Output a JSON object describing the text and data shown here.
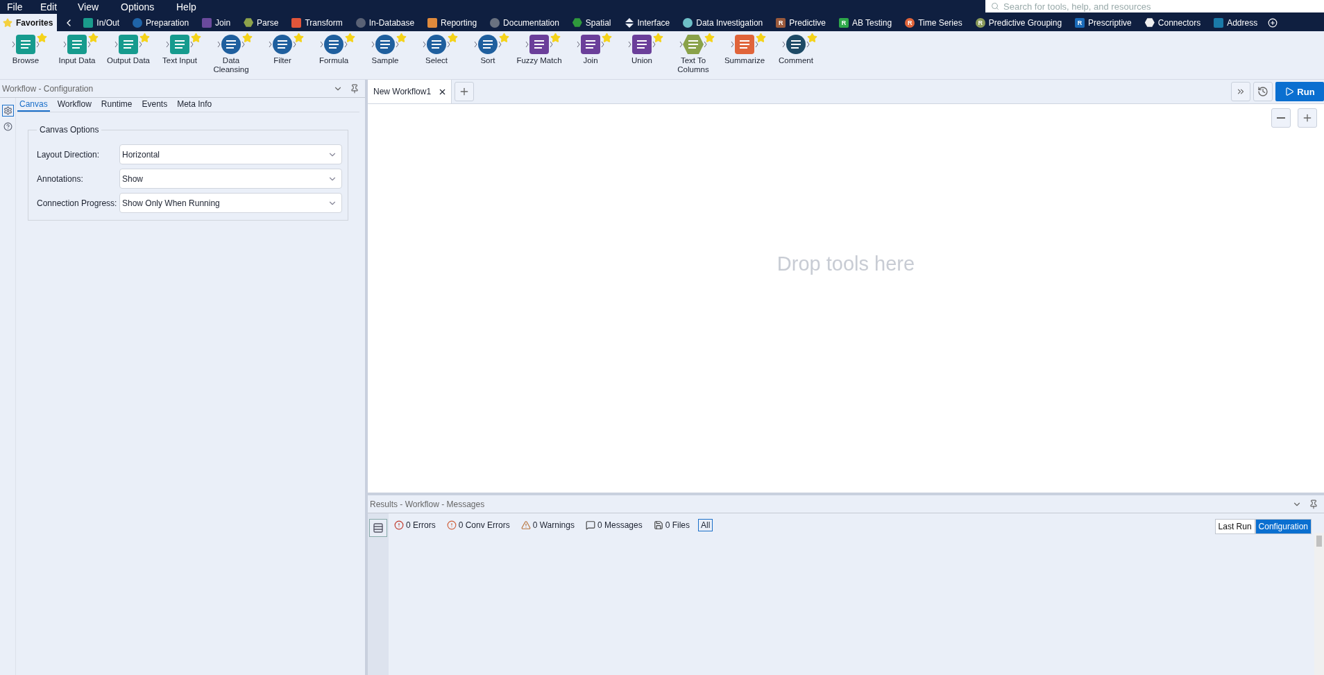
{
  "menu": [
    {
      "label": "File"
    },
    {
      "label": "Edit"
    },
    {
      "label": "View"
    },
    {
      "label": "Options"
    },
    {
      "label": "Help"
    }
  ],
  "search": {
    "placeholder": "Search for tools, help, and resources"
  },
  "category_tabs": [
    {
      "label": "Favorites",
      "selected": true,
      "kind": "star",
      "color": "#f4d03f"
    },
    {
      "label": "In/Out",
      "selected": false,
      "kind": "square",
      "color": "#1a9b8c"
    },
    {
      "label": "Preparation",
      "selected": false,
      "kind": "circle",
      "color": "#1f64a8"
    },
    {
      "label": "Join",
      "selected": false,
      "kind": "square",
      "color": "#6a4a9c"
    },
    {
      "label": "Parse",
      "selected": false,
      "kind": "hexagon",
      "color": "#8da24b"
    },
    {
      "label": "Transform",
      "selected": false,
      "kind": "square",
      "color": "#e0553a"
    },
    {
      "label": "In-Database",
      "selected": false,
      "kind": "circle",
      "color": "#5a6275"
    },
    {
      "label": "Reporting",
      "selected": false,
      "kind": "square",
      "color": "#e08a3c"
    },
    {
      "label": "Documentation",
      "selected": false,
      "kind": "circle",
      "color": "#6a7280"
    },
    {
      "label": "Spatial",
      "selected": false,
      "kind": "hexagon",
      "color": "#2f9a3c"
    },
    {
      "label": "Interface",
      "selected": false,
      "kind": "diamond",
      "color": "#e8ecf4"
    },
    {
      "label": "Data Investigation",
      "selected": false,
      "kind": "circle",
      "color": "#6ec0c8"
    },
    {
      "label": "Predictive",
      "selected": false,
      "kind": "badge",
      "color": "#9a5a3c",
      "badge": "R"
    },
    {
      "label": "AB Testing",
      "selected": false,
      "kind": "badge",
      "color": "#2ea84a",
      "badge": "R"
    },
    {
      "label": "Time Series",
      "selected": false,
      "kind": "round-badge",
      "color": "#e0643a",
      "badge": "R"
    },
    {
      "label": "Predictive Grouping",
      "selected": false,
      "kind": "round-badge",
      "color": "#8a9a5a",
      "badge": "R"
    },
    {
      "label": "Prescriptive",
      "selected": false,
      "kind": "badge",
      "color": "#1a6ab8",
      "badge": "R"
    },
    {
      "label": "Connectors",
      "selected": false,
      "kind": "hexagon",
      "color": "#f0f0f0"
    },
    {
      "label": "Address",
      "selected": false,
      "kind": "square",
      "color": "#1a7aa8"
    }
  ],
  "tools": [
    {
      "label": "Browse",
      "color": "#169b8e",
      "kind": "square"
    },
    {
      "label": "Input Data",
      "color": "#169b8e",
      "kind": "square"
    },
    {
      "label": "Output Data",
      "color": "#169b8e",
      "kind": "square"
    },
    {
      "label": "Text Input",
      "color": "#169b8e",
      "kind": "square"
    },
    {
      "label": "Data Cleansing",
      "color": "#1f5f9e",
      "kind": "circle"
    },
    {
      "label": "Filter",
      "color": "#1f5f9e",
      "kind": "circle"
    },
    {
      "label": "Formula",
      "color": "#1f5f9e",
      "kind": "circle"
    },
    {
      "label": "Sample",
      "color": "#1f5f9e",
      "kind": "circle"
    },
    {
      "label": "Select",
      "color": "#1f5f9e",
      "kind": "circle"
    },
    {
      "label": "Sort",
      "color": "#1f5f9e",
      "kind": "circle"
    },
    {
      "label": "Fuzzy Match",
      "color": "#6b3f9a",
      "kind": "square"
    },
    {
      "label": "Join",
      "color": "#6b3f9a",
      "kind": "square"
    },
    {
      "label": "Union",
      "color": "#6b3f9a",
      "kind": "square"
    },
    {
      "label": "Text To Columns",
      "color": "#8aa24a",
      "kind": "hexagon"
    },
    {
      "label": "Summarize",
      "color": "#e0643a",
      "kind": "square"
    },
    {
      "label": "Comment",
      "color": "#1e4a66",
      "kind": "circle"
    }
  ],
  "config_panel": {
    "title": "Workflow - Configuration",
    "side_icons": [
      {
        "kind": "settings",
        "selected": true
      },
      {
        "kind": "help",
        "selected": false
      }
    ],
    "tabs": [
      {
        "label": "Canvas",
        "selected": true
      },
      {
        "label": "Workflow",
        "selected": false
      },
      {
        "label": "Runtime",
        "selected": false
      },
      {
        "label": "Events",
        "selected": false
      },
      {
        "label": "Meta Info",
        "selected": false
      }
    ],
    "group": {
      "title": "Canvas Options",
      "fields": [
        {
          "label": "Layout Direction:",
          "value": "Horizontal"
        },
        {
          "label": "Annotations:",
          "value": "Show"
        },
        {
          "label": "Connection Progress:",
          "value": "Show Only When Running"
        }
      ]
    }
  },
  "workflow_tabs": [
    {
      "label": "New Workflow1",
      "selected": true
    }
  ],
  "run_button": {
    "label": "Run"
  },
  "canvas": {
    "placeholder": "Drop tools here"
  },
  "results": {
    "title": "Results - Workflow - Messages",
    "filters": [
      {
        "kind": "error",
        "label": "0 Errors",
        "selected": false
      },
      {
        "kind": "conv_error",
        "label": "0 Conv Errors",
        "selected": false
      },
      {
        "kind": "warning",
        "label": "0 Warnings",
        "selected": false
      },
      {
        "kind": "message",
        "label": "0 Messages",
        "selected": false
      },
      {
        "kind": "file",
        "label": "0 Files",
        "selected": false
      },
      {
        "kind": "all",
        "label": "All",
        "selected": true
      }
    ],
    "views": [
      {
        "label": "Last Run",
        "selected": false
      },
      {
        "label": "Configuration",
        "selected": true
      }
    ]
  }
}
